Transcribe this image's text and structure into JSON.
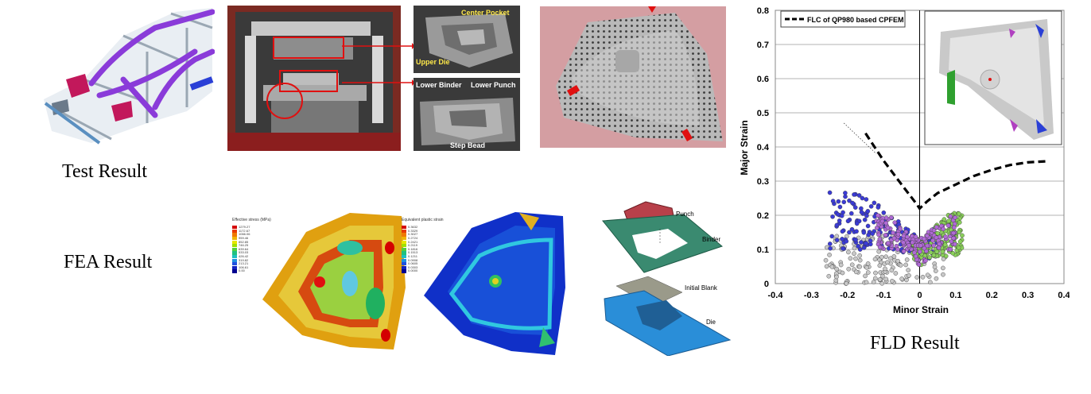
{
  "captions": {
    "test": "Test Result",
    "fea": "FEA Result",
    "fld": "FLD Result"
  },
  "photo_labels": {
    "center_pocket": "Center Pocket",
    "upper_die": "Upper Die",
    "lower_binder": "Lower Binder",
    "lower_punch": "Lower Punch",
    "step_bead": "Step Bead"
  },
  "tool_labels": {
    "punch": "Punch",
    "binder": "Binder",
    "initial_blank": "Initial Blank",
    "die": "Die"
  },
  "legends": {
    "stress_title": "Effective stress (MPa)",
    "stress_values": [
      "1279.27",
      "1172.67",
      "1066.06",
      "959.46",
      "852.85",
      "746.25",
      "639.64",
      "533.03",
      "426.42",
      "319.82",
      "213.21",
      "106.61",
      "0.00"
    ],
    "strain_title": "Equivalent plastic strain",
    "strain_values": [
      "0.3632",
      "0.3329",
      "0.3027",
      "0.2724",
      "0.2421",
      "0.2119",
      "0.1816",
      "0.1513",
      "0.1211",
      "0.0908",
      "0.0605",
      "0.0303",
      "0.0000"
    ],
    "scale_colors": [
      "#d40000",
      "#e83c00",
      "#f07800",
      "#f0b400",
      "#e6e600",
      "#a0e000",
      "#50d040",
      "#20c080",
      "#20c0c0",
      "#2090e0",
      "#2050e0",
      "#1020c0",
      "#000090"
    ]
  },
  "chart_data": {
    "type": "scatter",
    "xlabel": "Minor Strain",
    "ylabel": "Major Strain",
    "xlim": [
      -0.4,
      0.4
    ],
    "ylim": [
      0,
      0.8
    ],
    "xticks": [
      "-0.4",
      "-0.3",
      "-0.2",
      "-0.1",
      "0",
      "0.1",
      "0.2",
      "0.3",
      "0.4"
    ],
    "yticks": [
      "0",
      "0.1",
      "0.2",
      "0.3",
      "0.4",
      "0.5",
      "0.6",
      "0.7",
      "0.8"
    ],
    "grid": "horizontal",
    "legend_position": "top-left",
    "series": [
      {
        "name": "FLC of QP980 based CPFEM",
        "style": "dashed",
        "x": [
          -0.15,
          -0.1,
          -0.05,
          -0.01,
          0.0,
          0.02,
          0.05,
          0.1,
          0.15,
          0.2,
          0.25,
          0.3,
          0.35
        ],
        "y": [
          0.44,
          0.36,
          0.29,
          0.235,
          0.22,
          0.24,
          0.265,
          0.29,
          0.315,
          0.333,
          0.347,
          0.355,
          0.358
        ]
      }
    ],
    "scatter_groups": [
      {
        "color": "#c8c8c8",
        "x_range": [
          -0.26,
          0.08
        ],
        "y_range": [
          0.0,
          0.14
        ]
      },
      {
        "color": "#3b3bd6",
        "x_range": [
          -0.25,
          0.05
        ],
        "y_range": [
          0.1,
          0.27
        ]
      },
      {
        "color": "#8ad05a",
        "x_range": [
          -0.02,
          0.12
        ],
        "y_range": [
          0.08,
          0.21
        ]
      },
      {
        "color": "#b06ad6",
        "x_range": [
          -0.12,
          0.1
        ],
        "y_range": [
          0.1,
          0.2
        ]
      }
    ]
  }
}
